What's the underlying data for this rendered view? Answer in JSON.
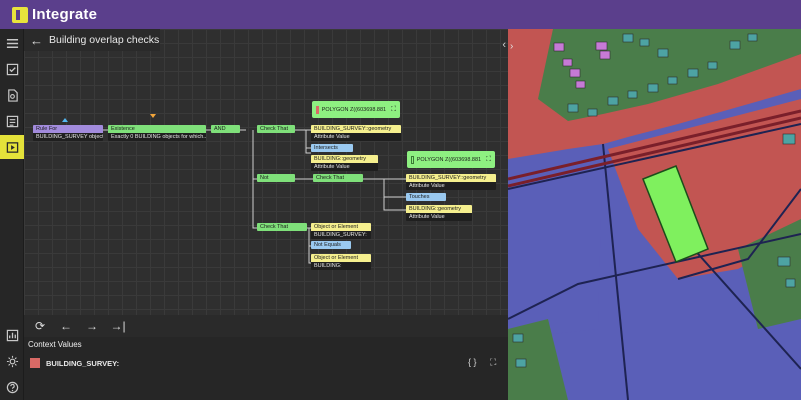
{
  "app": {
    "logo_text": "Integrate"
  },
  "editor": {
    "title": "Building overlap checks",
    "back_icon": "arrow-left-icon",
    "collapse_left": "‹",
    "map_collapse": "›"
  },
  "nodes": {
    "rule": {
      "head": "Rule For",
      "body": "BUILDING_SURVEY objects"
    },
    "existence": {
      "head": "Existence",
      "body": "Exactly 0 BUILDING objects for which..."
    },
    "and": {
      "head": "AND"
    },
    "check1": {
      "head": "Check That"
    },
    "not": {
      "head": "Not"
    },
    "check2": {
      "head": "Check That"
    },
    "check3": {
      "head": "Check That"
    },
    "bsg1": {
      "head": "BUILDING_SURVEY::geometry",
      "body": "Attribute Value"
    },
    "intersects": {
      "head": "Intersects"
    },
    "bg1": {
      "head": "BUILDING::geometry",
      "body": "Attribute Value"
    },
    "bsg2": {
      "head": "BUILDING_SURVEY::geometry",
      "body": "Attribute Value"
    },
    "touches": {
      "head": "Touches"
    },
    "bg2": {
      "head": "BUILDING::geometry",
      "body": "Attribute Value"
    },
    "obj1": {
      "head": "Object or Element",
      "body": "BUILDING_SURVEY:"
    },
    "notequals": {
      "head": "Not Equals"
    },
    "obj2": {
      "head": "Object or Element",
      "body": "BUILDING:"
    }
  },
  "popups": {
    "p1": {
      "text": "POLYGON Z((603698.881",
      "swatch": "#d96a66"
    },
    "p2": {
      "text": "POLYGON Z((603698.881",
      "swatch": "#8ef081"
    }
  },
  "toolbar": {
    "refresh": "⟳",
    "prev": "←",
    "next": "→",
    "last": "→|"
  },
  "context": {
    "title": "Context Values",
    "item_label": "BUILDING_SURVEY:",
    "swatch": "#d96a66",
    "braces": "{ }"
  },
  "rail": [
    "menu-icon",
    "checklist-icon",
    "document-search-icon",
    "list-check-icon",
    "play-panel-icon",
    "chart-icon",
    "settings-icon",
    "help-icon"
  ]
}
